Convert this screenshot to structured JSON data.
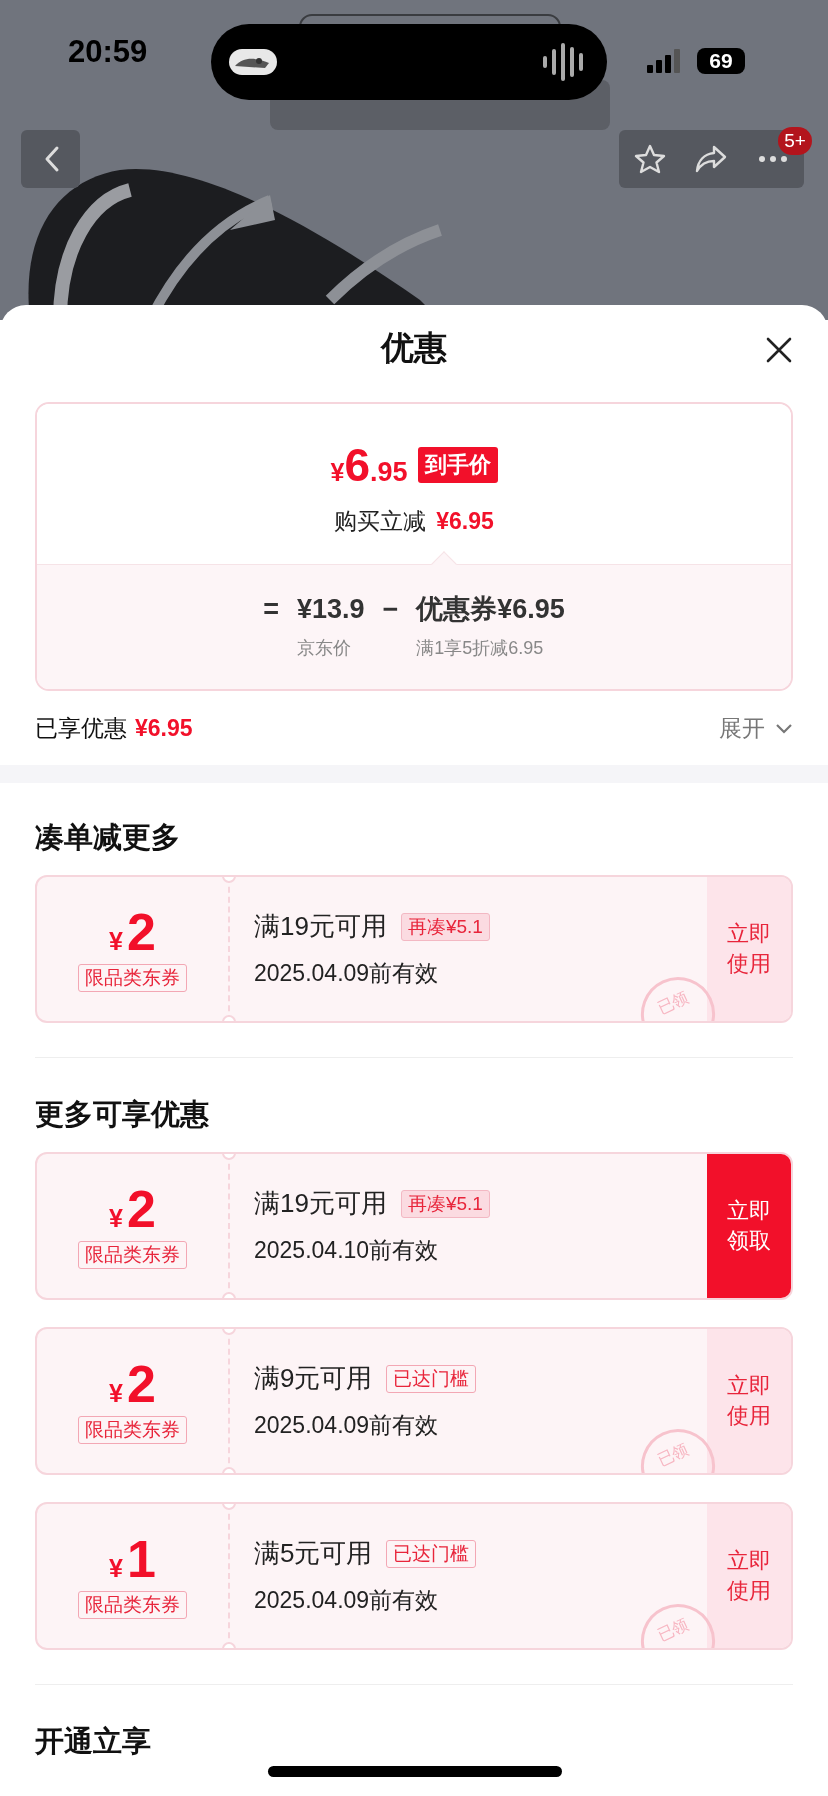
{
  "status_bar": {
    "time": "20:59",
    "battery": "69"
  },
  "nav": {
    "badge": "5+"
  },
  "sheet": {
    "title": "优惠"
  },
  "price_card": {
    "currency": "¥",
    "integer": "6",
    "decimal": ".95",
    "tag": "到手价",
    "reduction_label": "购买立减",
    "reduction_value": "¥6.95",
    "equals": "=",
    "base_price": "¥13.9",
    "base_label": "京东价",
    "minus": "−",
    "coupon_price": "优惠券¥6.95",
    "coupon_label": "满1享5折减6.95"
  },
  "savings": {
    "label": "已享优惠",
    "value": "¥6.95",
    "toggle": "展开",
    "expanded": false
  },
  "sections": [
    {
      "title": "凑单减更多",
      "coupons": [
        {
          "currency": "¥",
          "amount": "2",
          "scope": "限品类东券",
          "condition": "满19元可用",
          "tag": {
            "kind": "pending",
            "text": "再凑¥5.1"
          },
          "validity": "2025.04.09前有效",
          "action": "立即使用",
          "claimed": true,
          "stamp": "已领"
        }
      ]
    },
    {
      "title": "更多可享优惠",
      "coupons": [
        {
          "currency": "¥",
          "amount": "2",
          "scope": "限品类东券",
          "condition": "满19元可用",
          "tag": {
            "kind": "pending",
            "text": "再凑¥5.1"
          },
          "validity": "2025.04.10前有效",
          "action": "立即领取",
          "claimed": false
        },
        {
          "currency": "¥",
          "amount": "2",
          "scope": "限品类东券",
          "condition": "满9元可用",
          "tag": {
            "kind": "reached",
            "text": "已达门槛"
          },
          "validity": "2025.04.09前有效",
          "action": "立即使用",
          "claimed": true,
          "stamp": "已领"
        },
        {
          "currency": "¥",
          "amount": "1",
          "scope": "限品类东券",
          "condition": "满5元可用",
          "tag": {
            "kind": "reached",
            "text": "已达门槛"
          },
          "validity": "2025.04.09前有效",
          "action": "立即使用",
          "claimed": true,
          "stamp": "已领"
        }
      ]
    },
    {
      "title": "开通立享"
    }
  ]
}
